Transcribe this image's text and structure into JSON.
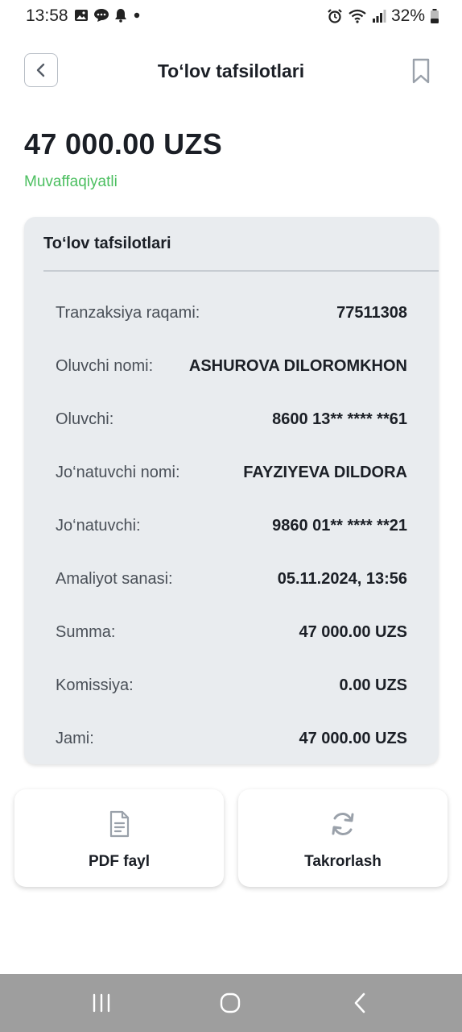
{
  "status_bar": {
    "time": "13:58",
    "left_icons": [
      "image-icon",
      "message-icon",
      "bell-icon",
      "dot-icon"
    ],
    "right_icons": [
      "alarm-icon",
      "wifi-icon",
      "signal-icon",
      "battery-icon"
    ],
    "battery": "32%"
  },
  "header": {
    "title": "To‘lov tafsilotlari",
    "back_icon": "chevron-left-icon",
    "bookmark_icon": "bookmark-icon"
  },
  "summary": {
    "amount": "47 000.00 UZS",
    "status": "Muvaffaqiyatli"
  },
  "details": {
    "title": "To‘lov tafsilotlari",
    "rows": [
      {
        "label": "Tranzaksiya raqami:",
        "value": "77511308"
      },
      {
        "label": "Oluvchi nomi:",
        "value": "ASHUROVA DILOROMKHON"
      },
      {
        "label": "Oluvchi:",
        "value": "8600 13** **** **61"
      },
      {
        "label": "Jo‘natuvchi nomi:",
        "value": "FAYZIYEVA DILDORA"
      },
      {
        "label": "Jo‘natuvchi:",
        "value": "9860 01** **** **21"
      },
      {
        "label": "Amaliyot sanasi:",
        "value": "05.11.2024, 13:56"
      },
      {
        "label": "Summa:",
        "value": "47 000.00 UZS"
      },
      {
        "label": "Komissiya:",
        "value": "0.00 UZS"
      },
      {
        "label": "Jami:",
        "value": "47 000.00 UZS"
      }
    ]
  },
  "actions": {
    "pdf": {
      "label": "PDF fayl",
      "icon": "document-icon"
    },
    "repeat": {
      "label": "Takrorlash",
      "icon": "refresh-icon"
    }
  },
  "nav": {
    "recents_icon": "recents-icon",
    "home_icon": "home-icon",
    "back_icon": "back-icon"
  },
  "colors": {
    "success": "#4cbf60",
    "card_bg": "#e9ecef",
    "navbar_bg": "#9e9e9e"
  }
}
